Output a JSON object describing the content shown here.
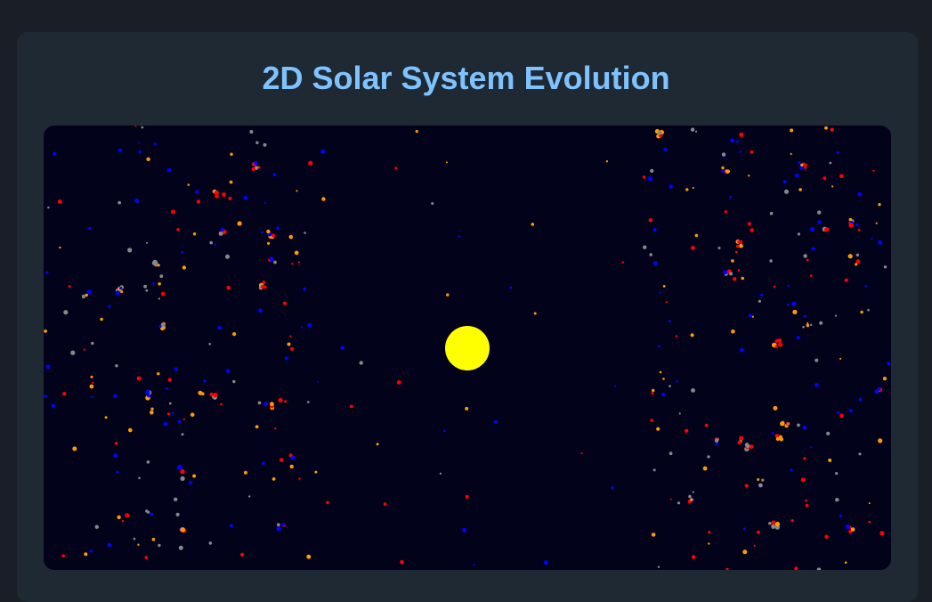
{
  "page": {
    "title": "2D Solar System Evolution"
  },
  "colors": {
    "page_bg": "#1a1f27",
    "card_bg": "#1f2933",
    "title_text": "#7ec3ff",
    "space_bg": "#02021a",
    "sun": "#ffff00",
    "particle_palette": [
      "#ff0000",
      "#ff9900",
      "#0000ff",
      "#888888"
    ]
  },
  "simulation": {
    "sun": {
      "label": "",
      "icon": "sun-circle"
    },
    "particles_rendered": "random-field"
  }
}
